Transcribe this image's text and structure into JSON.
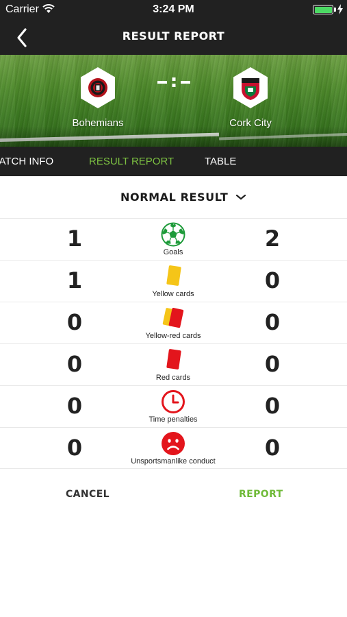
{
  "status_bar": {
    "carrier": "Carrier",
    "time": "3:24 PM",
    "battery_level": 1.0,
    "icons": [
      "wifi-icon",
      "battery-icon",
      "charging-icon"
    ]
  },
  "nav": {
    "title": "RESULT REPORT",
    "back_icon": "chevron-left-icon"
  },
  "match": {
    "home_team": "Bohemians",
    "away_team": "Cork City",
    "score_separator_icon": "dash-colon-dash-icon"
  },
  "tabs": [
    {
      "label": "MATCH INFO",
      "active": false
    },
    {
      "label": "RESULT REPORT",
      "active": true
    },
    {
      "label": "TABLE",
      "active": false
    }
  ],
  "result_type": {
    "label": "NORMAL RESULT",
    "icon": "chevron-down-icon"
  },
  "stats": [
    {
      "label": "Goals",
      "home": "1",
      "away": "2",
      "icon": "soccer-ball-icon"
    },
    {
      "label": "Yellow cards",
      "home": "1",
      "away": "0",
      "icon": "yellow-card-icon"
    },
    {
      "label": "Yellow-red cards",
      "home": "0",
      "away": "0",
      "icon": "yellow-red-card-icon"
    },
    {
      "label": "Red cards",
      "home": "0",
      "away": "0",
      "icon": "red-card-icon"
    },
    {
      "label": "Time penalties",
      "home": "0",
      "away": "0",
      "icon": "clock-icon"
    },
    {
      "label": "Unsportsmanlike conduct",
      "home": "0",
      "away": "0",
      "icon": "sad-face-icon"
    }
  ],
  "actions": {
    "cancel_label": "CANCEL",
    "report_label": "REPORT"
  },
  "colors": {
    "accent": "#7dc242",
    "bar": "#212121",
    "card_yellow": "#f5c518",
    "card_red": "#e3151c",
    "goal_green": "#1e9b3a"
  }
}
